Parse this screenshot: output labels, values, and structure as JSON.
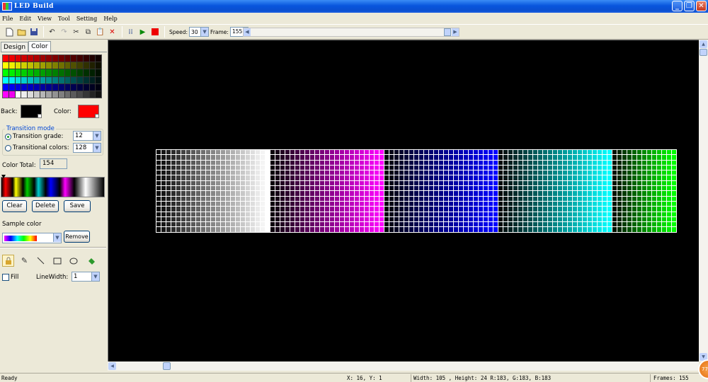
{
  "window": {
    "title": "LED Build"
  },
  "menu": [
    "File",
    "Edit",
    "View",
    "Tool",
    "Setting",
    "Help"
  ],
  "toolbar": {
    "icons": [
      "new-icon",
      "open-icon",
      "save-icon",
      "undo-icon",
      "redo-icon",
      "cut-icon",
      "copy-icon",
      "paste-icon",
      "delete-icon",
      "grid-icon",
      "play-icon",
      "stop-icon"
    ],
    "speed_label": "Speed:",
    "speed_value": "30",
    "frame_label": "Frame:",
    "frame_value": "155"
  },
  "tabs": {
    "design": "Design",
    "color": "Color"
  },
  "color_panel": {
    "back_label": "Back:",
    "back_color": "#000000",
    "color_label": "Color:",
    "color_value": "#ff0000",
    "transition_mode_title": "Transition mode",
    "transition_grade_label": "Transition grade:",
    "transition_grade_value": "12",
    "transitional_colors_label": "Transitional colors:",
    "transitional_colors_value": "128",
    "color_total_label": "Color Total:",
    "color_total_value": "154",
    "clear_button": "Clear",
    "delete_button": "Delete",
    "save_button": "Save",
    "sample_color_label": "Sample color",
    "remove_button": "Remove",
    "fill_label": "Fill",
    "linewidth_label": "LineWidth:",
    "linewidth_value": "1"
  },
  "palette_base_colors": [
    "#ff0000",
    "#ffff00",
    "#00ff00",
    "#00ffff",
    "#0000ff",
    "#ff00ff"
  ],
  "led_display": {
    "columns": 105,
    "rows": 16,
    "segment_colors": [
      "#ffffff",
      "#ff00ff",
      "#0000ff",
      "#00ffff",
      "#00ff00"
    ]
  },
  "status": {
    "ready": "Ready",
    "coords": "X: 16, Y: 1",
    "size_info": "Width: 105 , Height: 24 R:183, G:183, B:183",
    "frames": "Frames:  155"
  },
  "badge": "77"
}
